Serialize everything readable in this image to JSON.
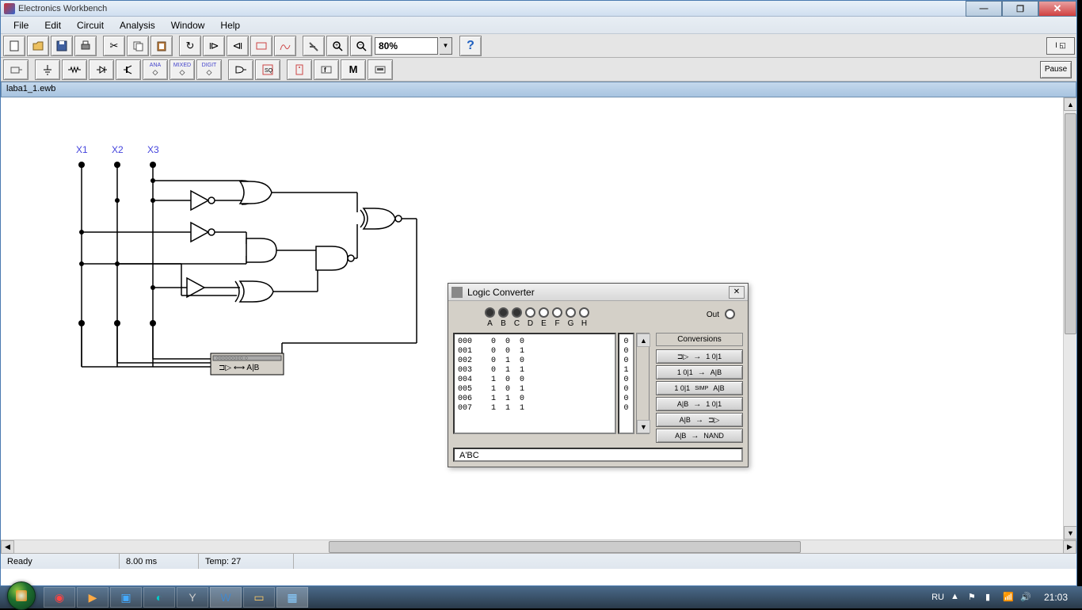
{
  "titlebar": {
    "app_name": "Electronics Workbench"
  },
  "menu": [
    "File",
    "Edit",
    "Circuit",
    "Analysis",
    "Window",
    "Help"
  ],
  "toolbar1": {
    "zoom_value": "80%",
    "help_label": "?",
    "switch_label": "I ◱",
    "pause_label": "Pause"
  },
  "comp_toolbar": {
    "labels": [
      "",
      "",
      "",
      "",
      "",
      "ANA",
      "MIXED",
      "DIGIT",
      "",
      "",
      "",
      "",
      "f",
      "M",
      ""
    ]
  },
  "doc": {
    "filename": "laba1_1.ewb"
  },
  "circuit": {
    "inputs": [
      "X1",
      "X2",
      "X3"
    ],
    "instrument_text": "A|B"
  },
  "logic_converter": {
    "title": "Logic Converter",
    "inputs": [
      "A",
      "B",
      "C",
      "D",
      "E",
      "F",
      "G",
      "H"
    ],
    "active_inputs": 3,
    "out_label": "Out",
    "truth_rows": [
      {
        "idx": "000",
        "bits": "0  0  0",
        "out": "0"
      },
      {
        "idx": "001",
        "bits": "0  0  1",
        "out": "0"
      },
      {
        "idx": "002",
        "bits": "0  1  0",
        "out": "0"
      },
      {
        "idx": "003",
        "bits": "0  1  1",
        "out": "1"
      },
      {
        "idx": "004",
        "bits": "1  0  0",
        "out": "0"
      },
      {
        "idx": "005",
        "bits": "1  0  1",
        "out": "0"
      },
      {
        "idx": "006",
        "bits": "1  1  0",
        "out": "0"
      },
      {
        "idx": "007",
        "bits": "1  1  1",
        "out": "0"
      }
    ],
    "conv_title": "Conversions",
    "conv_buttons": [
      {
        "from": "⊐▷",
        "to": "1 0|1"
      },
      {
        "from": "1 0|1",
        "to": "A|B"
      },
      {
        "from": "1 0|1",
        "mid": "SIMP",
        "to": "A|B"
      },
      {
        "from": "A|B",
        "to": "1 0|1"
      },
      {
        "from": "A|B",
        "to": "⊐▷"
      },
      {
        "from": "A|B",
        "to": "NAND"
      }
    ],
    "expression": "A'BC"
  },
  "statusbar": {
    "ready": "Ready",
    "time": "8.00 ms",
    "temp": "Temp: 27"
  },
  "taskbar": {
    "lang": "RU",
    "clock": "21:03"
  }
}
